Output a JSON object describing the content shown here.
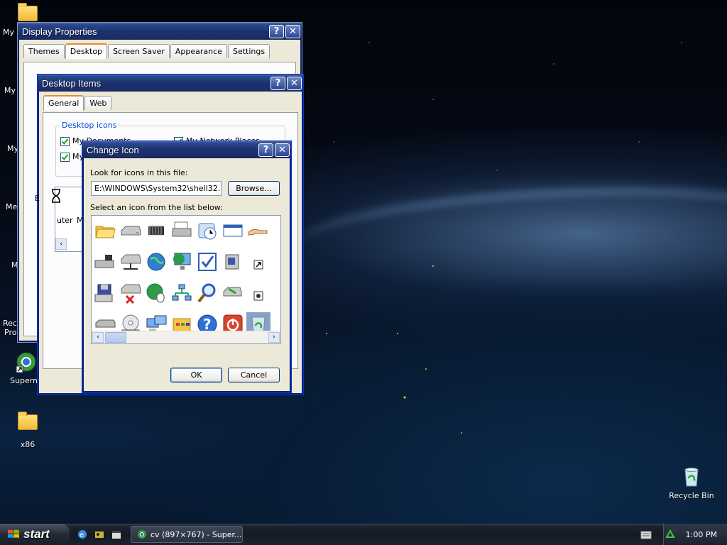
{
  "desktop": {
    "left_labels": [
      "My I",
      "My",
      "My",
      "Me",
      "M",
      "Rec",
      "Pro"
    ],
    "icons": [
      {
        "name": "supermium",
        "label": "Supermi"
      },
      {
        "name": "x86",
        "label": "x86"
      },
      {
        "name": "recycle-bin",
        "label": "Recycle Bin"
      }
    ]
  },
  "display_properties": {
    "title": "Display Properties",
    "tabs": [
      "Themes",
      "Desktop",
      "Screen Saver",
      "Appearance",
      "Settings"
    ],
    "active_tab": "Desktop"
  },
  "desktop_items": {
    "title": "Desktop Items",
    "tabs": [
      "General",
      "Web"
    ],
    "group_label": "Desktop icons",
    "checkboxes": [
      {
        "label": "My Documents",
        "checked": true
      },
      {
        "label": "My Network Places",
        "checked": true
      },
      {
        "label": "My",
        "checked": true
      }
    ],
    "partial_texts": [
      "uter",
      "M",
      "E"
    ]
  },
  "change_icon": {
    "title": "Change Icon",
    "file_label": "Look for icons in this file:",
    "file_value": "E:\\WINDOWS\\System32\\shell32.dll",
    "browse_label": "Browse...",
    "list_label": "Select an icon from the list below:",
    "ok_label": "OK",
    "cancel_label": "Cancel",
    "icons": [
      "folder-open-icon",
      "drive-icon",
      "chip-icon",
      "printer-icon",
      "clock-icon",
      "window-icon",
      "hand-icon",
      "partial-icon",
      "drive-share-icon",
      "network-drive-icon",
      "globe-icon",
      "monitor-globe-icon",
      "checklist-icon",
      "box-icon",
      "shortcut-arrow-icon",
      "folder-partial-icon",
      "floppy-icon",
      "network-drive-x-icon",
      "globe-mouse-icon",
      "network-icon",
      "magnifier-icon",
      "drive-green-icon",
      "settings-dot-icon",
      "partial-blue-icon",
      "flat-drive-icon",
      "cd-drive-icon",
      "computers-icon",
      "folder-grid-icon",
      "help-icon",
      "power-icon",
      "recycle-bin-icon",
      "partial-yellow-icon"
    ]
  },
  "taskbar": {
    "start_label": "start",
    "task_label": "cv (897×767) - Super...",
    "clock": "1:00 PM"
  },
  "colors": {
    "xp_title_dark": "#1c3170",
    "window_face": "#ece9d8",
    "tab_accent": "#e68b2c"
  }
}
